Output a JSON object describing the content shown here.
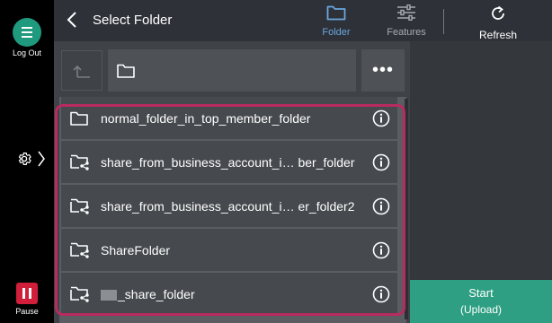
{
  "rail": {
    "logout_label": "Log Out",
    "pause_label": "Pause"
  },
  "header": {
    "title": "Select Folder",
    "tabs": [
      {
        "label": "Folder",
        "icon": "folder-icon",
        "active": true
      },
      {
        "label": "Features",
        "icon": "sliders-icon",
        "active": false
      },
      {
        "label": "Refresh",
        "icon": "refresh-icon",
        "active": false
      }
    ]
  },
  "path": {
    "more_label": "•••"
  },
  "folders": [
    {
      "name": "normal_folder_in_top_member_folder",
      "shared": false,
      "redacted": false
    },
    {
      "name": "share_from_business_account_i… ber_folder",
      "shared": true,
      "redacted": false
    },
    {
      "name": "share_from_business_account_i… er_folder2",
      "shared": true,
      "redacted": false
    },
    {
      "name": "ShareFolder",
      "shared": true,
      "redacted": false
    },
    {
      "name": "_share_folder",
      "shared": true,
      "redacted": true
    }
  ],
  "start": {
    "label": "Start",
    "sublabel": "(Upload)"
  },
  "colors": {
    "accent_green": "#2e9f83",
    "active_tab_blue": "#6aa7e0",
    "highlight_border": "#b92a5f",
    "pause_red": "#d11e3a"
  }
}
